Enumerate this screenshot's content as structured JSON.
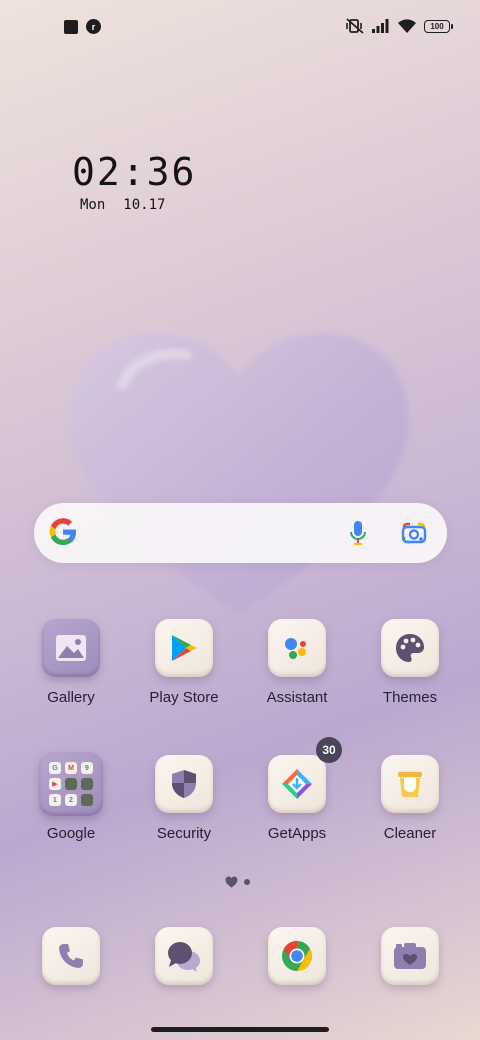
{
  "status_bar": {
    "left_icons": [
      "square-app-icon",
      "notification-app-icon"
    ],
    "right_icons": [
      "silent-vibrate-icon",
      "signal-icon",
      "wifi-icon",
      "battery-icon"
    ],
    "battery_level": "100"
  },
  "clock_widget": {
    "time": "02:36",
    "day": "Mon",
    "date": "10.17"
  },
  "search": {
    "icons": [
      "google-g-icon",
      "mic-icon",
      "lens-icon"
    ]
  },
  "apps": [
    {
      "label": "Gallery"
    },
    {
      "label": "Play Store"
    },
    {
      "label": "Assistant"
    },
    {
      "label": "Themes"
    },
    {
      "label": "Google"
    },
    {
      "label": "Security"
    },
    {
      "label": "GetApps",
      "badge": "30"
    },
    {
      "label": "Cleaner"
    }
  ],
  "folder_icons": [
    "G",
    "M",
    "9",
    "▶",
    "",
    "",
    "1",
    "2",
    ""
  ],
  "dock": [
    "phone-icon",
    "messages-icon",
    "chrome-icon",
    "camera-icon"
  ],
  "page_indicator": {
    "pages": 2,
    "current": 1
  },
  "colors": {
    "tile": "#f6efe7",
    "accent_purple": "#8f7eae",
    "badge": "#4a4458"
  }
}
